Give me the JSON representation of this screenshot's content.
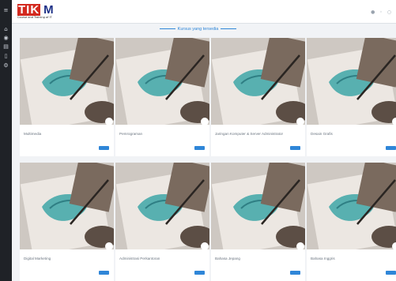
{
  "brand": {
    "logo_main": "TIK",
    "logo_rest": " M",
    "subtitle": "Course and Training of IT"
  },
  "section": {
    "title": "Kursus yang tersedia"
  },
  "courses": [
    {
      "title": "Multimedia"
    },
    {
      "title": "Pemrograman"
    },
    {
      "title": "Jaringan Komputer & Server Administrator"
    },
    {
      "title": "Desain Grafis"
    },
    {
      "title": "Digital Marketing"
    },
    {
      "title": "Administrasi Perkantoran"
    },
    {
      "title": "Bahasa Jepang"
    },
    {
      "title": "Bahasa Inggris"
    }
  ],
  "icons": {
    "sidebar": [
      "menu-icon",
      "home-icon",
      "dashboard-icon",
      "list-icon",
      "document-icon",
      "settings-icon"
    ],
    "top": [
      "user-icon",
      "notification-icon",
      "logout-icon"
    ]
  },
  "colors": {
    "accent": "#2f86d8",
    "sidebar": "#1f2227",
    "brand_red": "#d32a1f",
    "brand_blue": "#1b2f86"
  }
}
